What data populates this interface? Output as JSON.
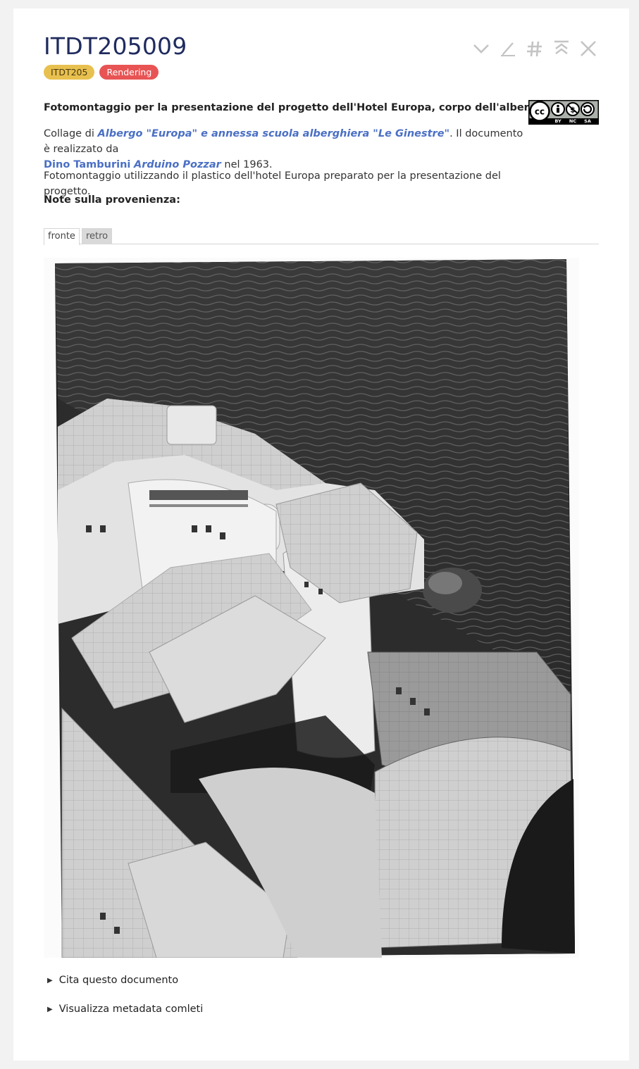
{
  "header": {
    "title": "ITDT205009",
    "badges": [
      {
        "label": "ITDT205",
        "color": "#e8c04f"
      },
      {
        "label": "Rendering",
        "color": "#e85454"
      }
    ]
  },
  "toolbar": {
    "icons": [
      "chevron-down-icon",
      "edit-icon",
      "hash-icon",
      "collapse-up-icon",
      "close-icon"
    ]
  },
  "document": {
    "heading": "Fotomontaggio per la presentazione del progetto dell'Hotel Europa, corpo dell'albergo",
    "license": {
      "icon": "cc-by-nc-sa-icon",
      "labels": [
        "BY",
        "NC",
        "SA"
      ]
    },
    "collage_prefix": "Collage di ",
    "collage_link": "Albergo \"Europa\" e annessa scuola alberghiera \"Le Ginestre\"",
    "collage_suffix": ". Il documento è realizzato da",
    "author_1": "Dino Tamburini",
    "author_2": "Arduino Pozzar",
    "year_text": " nel 1963.",
    "description": "Fotomontaggio utilizzando il plastico dell'hotel Europa preparato per la presentazione del progetto.",
    "provenance_label": "Note sulla provenienza:"
  },
  "tabs": [
    {
      "label": "fronte",
      "active": true
    },
    {
      "label": "retro",
      "active": false
    }
  ],
  "expanders": {
    "cite": "Cita questo documento",
    "metadata": "Visualizza metadata comleti"
  }
}
